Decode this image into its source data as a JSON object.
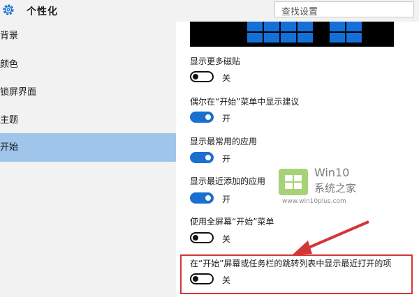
{
  "header": {
    "icon": "gear-icon",
    "title": "个性化",
    "search_placeholder": "查找设置"
  },
  "sidebar": {
    "items": [
      {
        "label": "背景",
        "active": false
      },
      {
        "label": "颜色",
        "active": false
      },
      {
        "label": "锁屏界面",
        "active": false
      },
      {
        "label": "主题",
        "active": false
      },
      {
        "label": "开始",
        "active": true
      }
    ]
  },
  "settings": [
    {
      "label": "显示更多磁贴",
      "on": false,
      "state": "关"
    },
    {
      "label": "偶尔在“开始”菜单中显示建议",
      "on": true,
      "state": "开"
    },
    {
      "label": "显示最常用的应用",
      "on": true,
      "state": "开"
    },
    {
      "label": "显示最近添加的应用",
      "on": true,
      "state": "开"
    },
    {
      "label": "使用全屏幕“开始”菜单",
      "on": false,
      "state": "关"
    },
    {
      "label": "在“开始”屏幕或任务栏的跳转列表中显示最近打开的项",
      "on": false,
      "state": "关"
    }
  ],
  "watermark": {
    "title": "Win10",
    "subtitle": "系统之家",
    "url": "www.win10plus.com"
  },
  "colors": {
    "accent": "#1a6fd0",
    "active_nav": "#9fc6ea",
    "highlight": "#d23636"
  }
}
